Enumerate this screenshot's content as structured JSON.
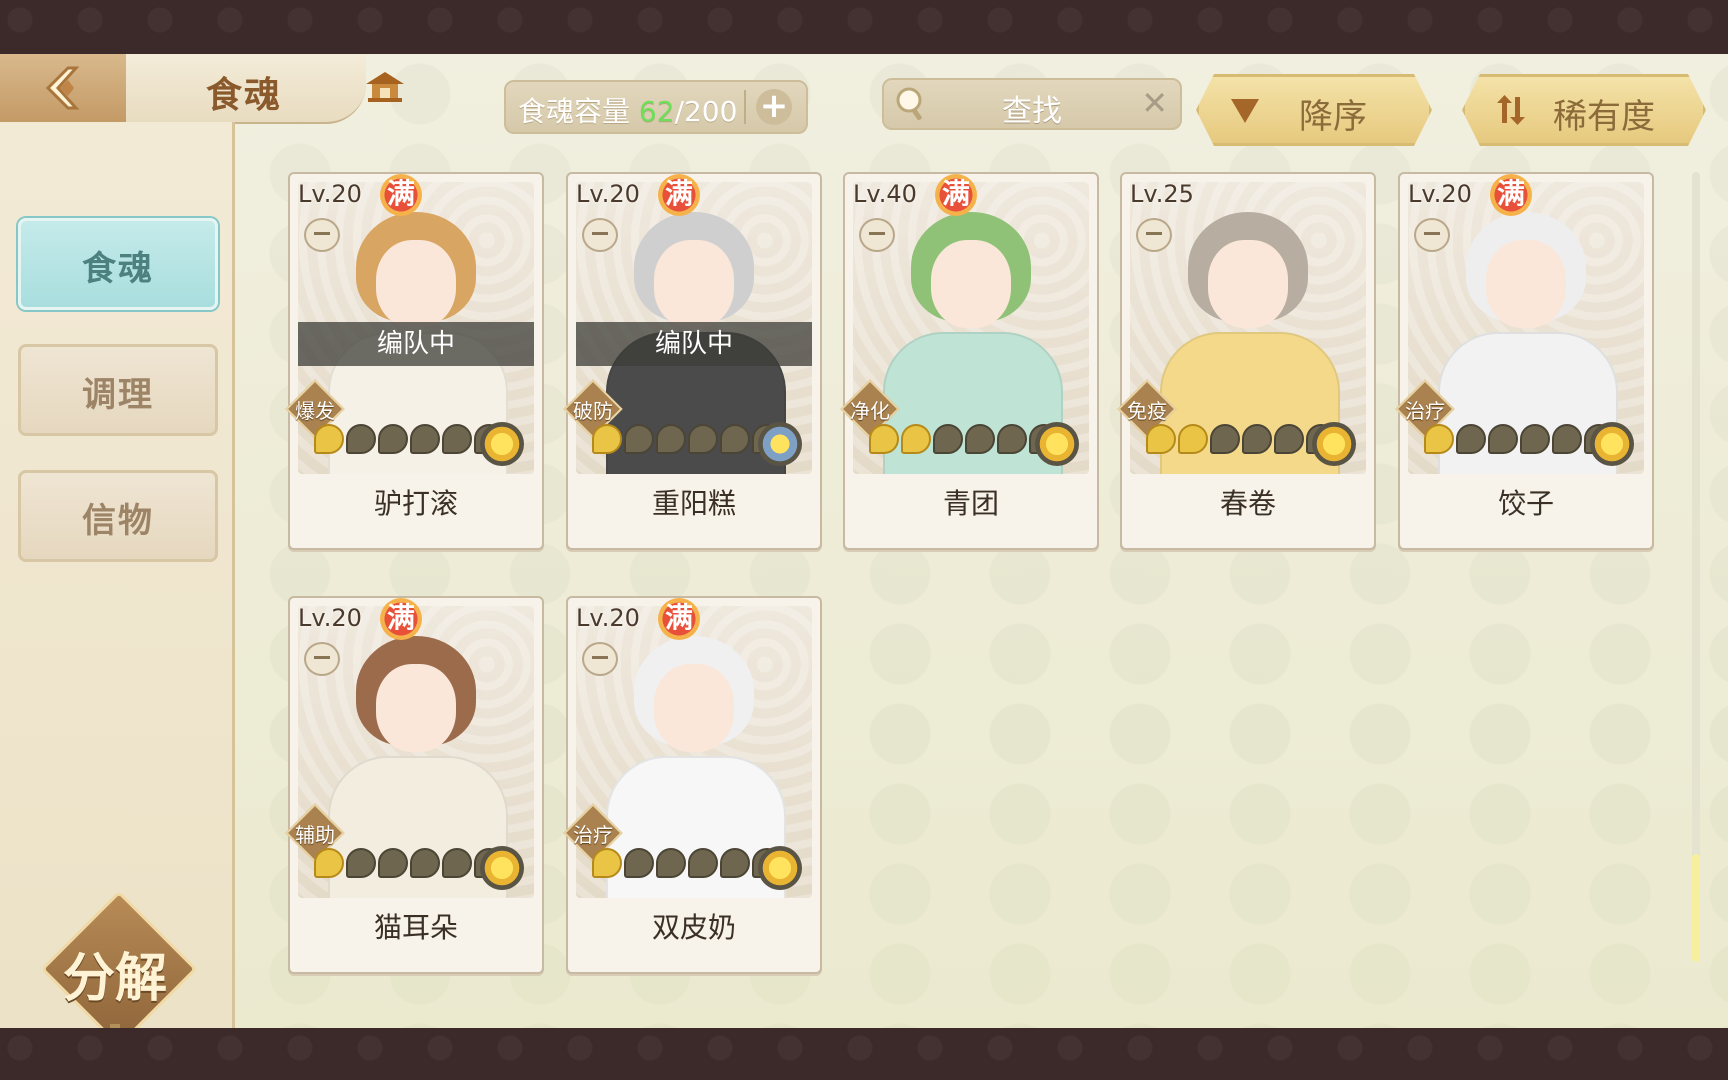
{
  "header": {
    "title": "食魂",
    "capacity_label": "食魂容量",
    "capacity_current": "62",
    "capacity_total": "/200",
    "search_placeholder": "查找",
    "sort_order": "降序",
    "sort_field": "稀有度"
  },
  "sidebar": {
    "tabs": [
      {
        "label": "食魂",
        "active": true
      },
      {
        "label": "调理",
        "active": false
      },
      {
        "label": "信物",
        "active": false
      }
    ],
    "decompose_label": "分解"
  },
  "cards": [
    {
      "level": "Lv.20",
      "badge": "满",
      "in_team": "编队中",
      "role": "爆发",
      "stars": 1,
      "max_stars": 6,
      "name": "驴打滚",
      "hair": "#d9a562",
      "outfit": "#f6f1e6"
    },
    {
      "level": "Lv.20",
      "badge": "满",
      "in_team": "编队中",
      "role": "破防",
      "stars": 1,
      "max_stars": 6,
      "name": "重阳糕",
      "hair": "#cfcfcf",
      "outfit": "#4b4b4b"
    },
    {
      "level": "Lv.40",
      "badge": "满",
      "in_team": "",
      "role": "净化",
      "stars": 2,
      "max_stars": 6,
      "name": "青团",
      "hair": "#8fc277",
      "outfit": "#bfe4d5"
    },
    {
      "level": "Lv.25",
      "badge": "",
      "in_team": "",
      "role": "免疫",
      "stars": 2,
      "max_stars": 6,
      "name": "春卷",
      "hair": "#b7ada0",
      "outfit": "#f4d98a"
    },
    {
      "level": "Lv.20",
      "badge": "满",
      "in_team": "",
      "role": "治疗",
      "stars": 1,
      "max_stars": 6,
      "name": "饺子",
      "hair": "#eeeeee",
      "outfit": "#f2f2f2"
    },
    {
      "level": "Lv.20",
      "badge": "满",
      "in_team": "",
      "role": "辅助",
      "stars": 1,
      "max_stars": 6,
      "name": "猫耳朵",
      "hair": "#9c6b4b",
      "outfit": "#f3ede0"
    },
    {
      "level": "Lv.20",
      "badge": "满",
      "in_team": "",
      "role": "治疗",
      "stars": 1,
      "max_stars": 6,
      "name": "双皮奶",
      "hair": "#f0f0f0",
      "outfit": "#f7f7f7"
    }
  ],
  "colors": {
    "capacity_current": "#6ddf58",
    "active_tab": "#a9dede",
    "accent_gold": "#e6c97e"
  },
  "icons": {
    "back": "back-arrow-icon",
    "home": "pavilion-icon",
    "search": "magnifier-icon",
    "clear": "close-icon",
    "sort_order": "triangle-down-icon",
    "sort_field": "swap-arrows-icon",
    "flower": "flower-icon",
    "bowl": "bowl-icon"
  }
}
